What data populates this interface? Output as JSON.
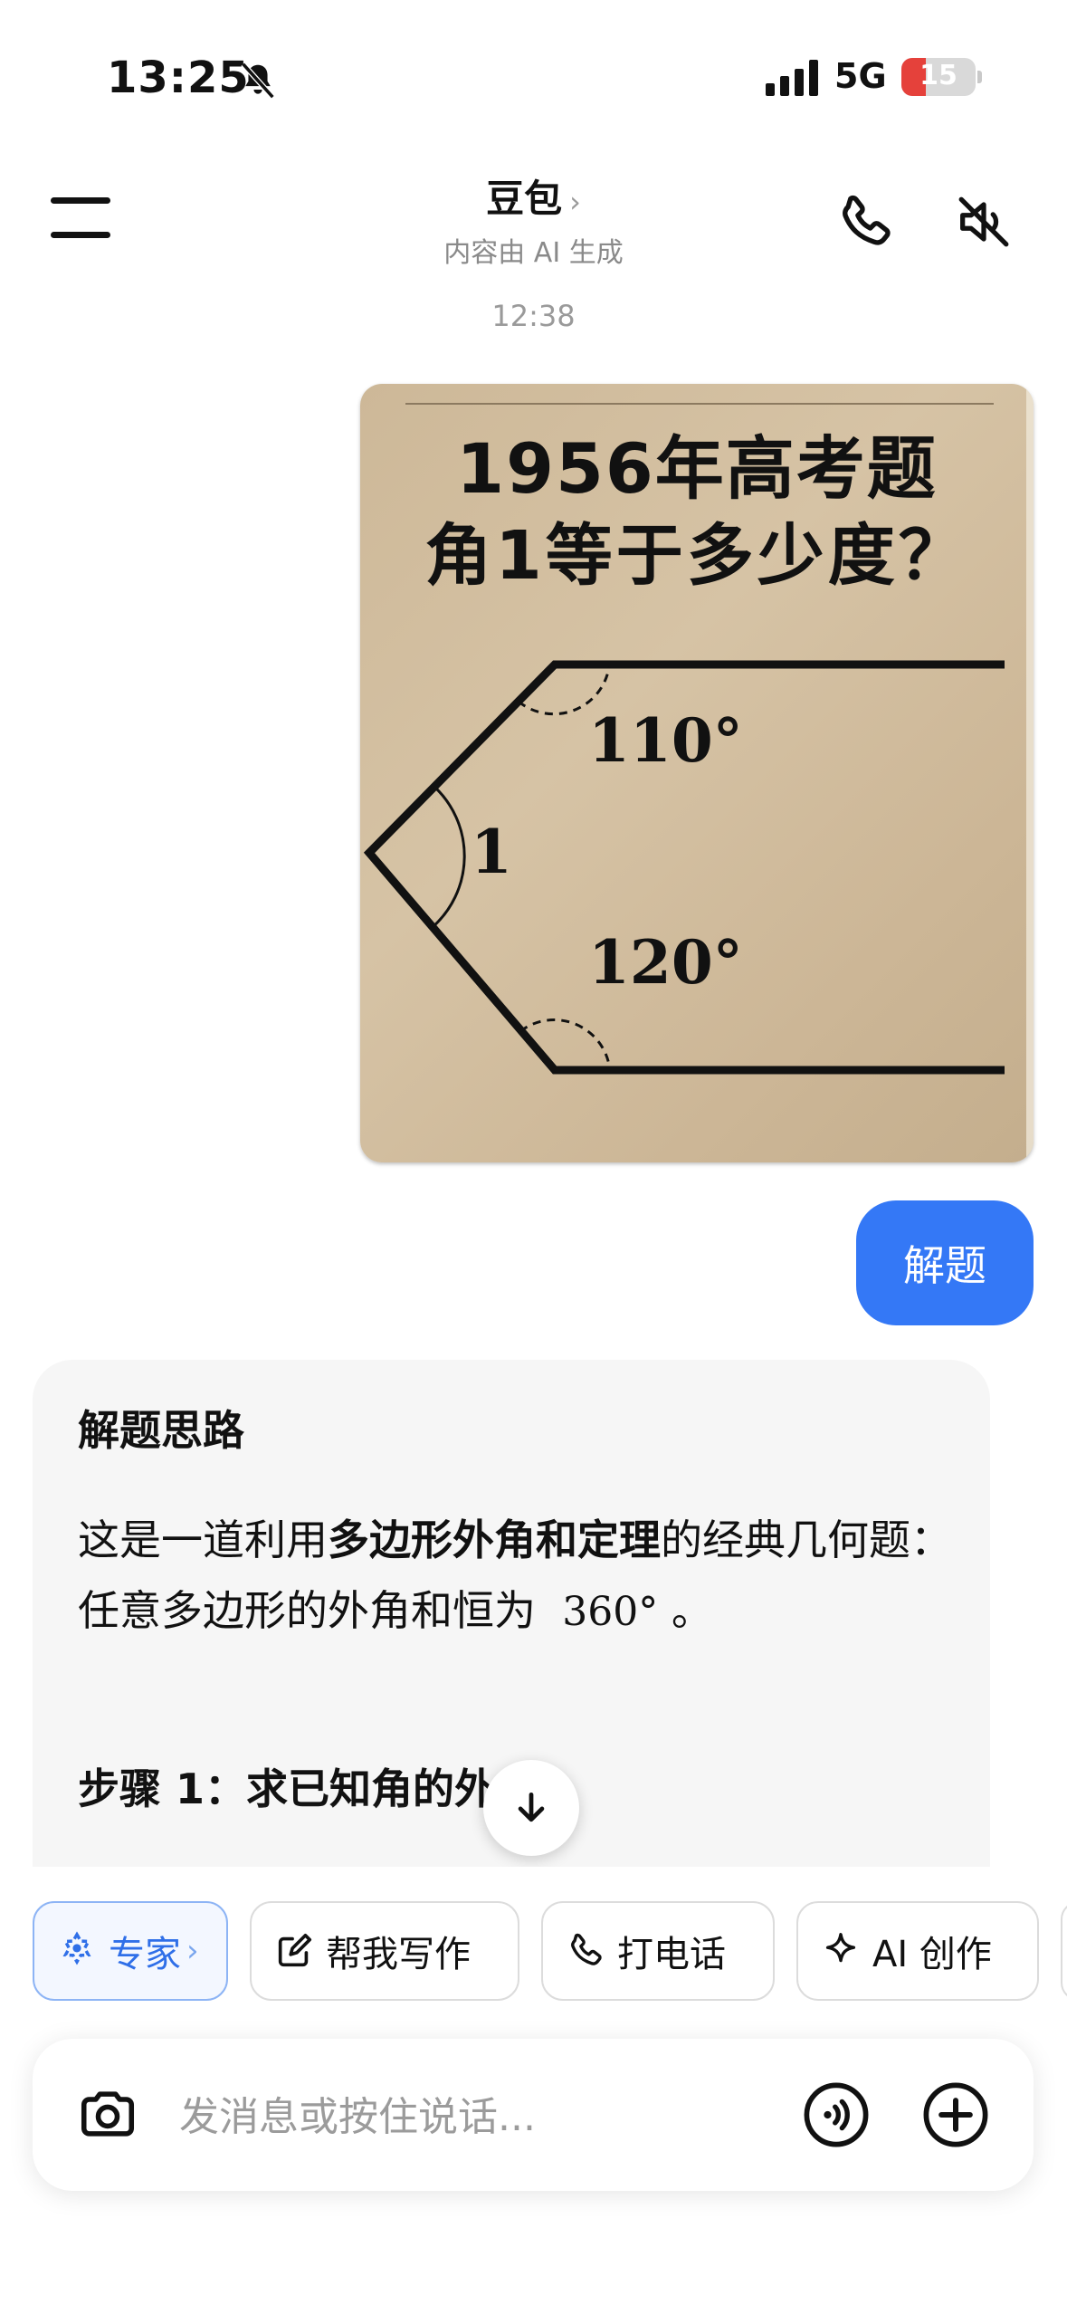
{
  "status_bar": {
    "time": "13:25",
    "network": "5G",
    "battery_level": "15",
    "battery_fraction": 0.15,
    "icons": [
      "bell-slash-icon",
      "signal-bars-icon",
      "battery-icon"
    ]
  },
  "header": {
    "title": "豆包",
    "title_chevron": "›",
    "subtitle": "内容由 AI 生成",
    "icons": [
      "menu-icon",
      "phone-icon",
      "speaker-muted-icon"
    ]
  },
  "chat": {
    "timestamp": "12:38",
    "image_message": {
      "title_line1": "1956年高考题",
      "title_line2": "角1等于多少度？",
      "angle_top": "110°",
      "angle_middle": "1",
      "angle_bottom": "120°"
    },
    "user_message": "解题",
    "answer": {
      "heading": "解题思路",
      "para_pre": "这是一道利用",
      "para_bold": "多边形外角和定理",
      "para_post": "的经典几何题：",
      "line2_pre": "任意多边形的外角和恒为",
      "line2_math": "360°",
      "line2_post": "。",
      "step1_visible": "步骤 1：求已知角的外"
    }
  },
  "scroll_down_icon": "arrow-down-icon",
  "quick_actions": [
    {
      "label": "专家",
      "icon": "expert-icon",
      "chevron": "›"
    },
    {
      "label": "帮我写作",
      "icon": "edit-icon"
    },
    {
      "label": "打电话",
      "icon": "phone-icon"
    },
    {
      "label": "AI 创作",
      "icon": "sparkle-icon"
    }
  ],
  "input_bar": {
    "placeholder": "发消息或按住说话...",
    "icons": [
      "camera-icon",
      "voice-icon",
      "plus-icon"
    ]
  },
  "colors": {
    "accent_blue": "#3478f6",
    "card_bg": "#f6f6f6",
    "battery_red": "#e5413b",
    "image_bg": "#d6c3a5"
  }
}
